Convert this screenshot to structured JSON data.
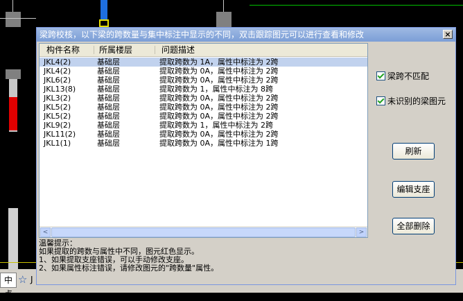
{
  "dialog": {
    "title": "梁跨校核，以下梁的跨数量与集中标注中显示的不同，双击跟踪图元可以进行查看和修改",
    "close_glyph": "×",
    "columns": [
      "构件名称",
      "所属楼层",
      "问题描述"
    ],
    "rows": [
      {
        "name": "JKL4(2)",
        "floor": "基础层",
        "desc": "提取跨数为 1A，属性中标注为 2跨"
      },
      {
        "name": "JKL4(2)",
        "floor": "基础层",
        "desc": "提取跨数为 0A，属性中标注为 2跨"
      },
      {
        "name": "JKL6(2)",
        "floor": "基础层",
        "desc": "提取跨数为 0A，属性中标注为 2跨"
      },
      {
        "name": "JKL13(8)",
        "floor": "基础层",
        "desc": "提取跨数为 1，属性中标注为 8跨"
      },
      {
        "name": "JKL3(2)",
        "floor": "基础层",
        "desc": "提取跨数为 0A，属性中标注为 2跨"
      },
      {
        "name": "JKL5(2)",
        "floor": "基础层",
        "desc": "提取跨数为 0A，属性中标注为 2跨"
      },
      {
        "name": "JKL5(2)",
        "floor": "基础层",
        "desc": "提取跨数为 0A，属性中标注为 2跨"
      },
      {
        "name": "JKL9(2)",
        "floor": "基础层",
        "desc": "提取跨数为 1，属性中标注为 2跨"
      },
      {
        "name": "JKL11(2)",
        "floor": "基础层",
        "desc": "提取跨数为 0A，属性中标注为 2跨"
      },
      {
        "name": "JKL1(1)",
        "floor": "基础层",
        "desc": "提取跨数为 0A，属性中标注为 1跨"
      }
    ],
    "selected_row": 0,
    "hints": [
      "温馨提示：",
      "如果提取的跨数与属性中不同，图元红色显示。",
      "1、如果提取支座错误，可以手动修改支座。",
      "2、如果属性标注错误，请修改图元的\"跨数量\"属性。"
    ],
    "checkboxes": [
      {
        "label": "梁跨不匹配",
        "checked": true
      },
      {
        "label": "未识别的梁图元",
        "checked": true
      }
    ],
    "buttons": {
      "refresh": "刷新",
      "edit_support": "编辑支座",
      "delete_all": "全部删除"
    },
    "scroll_left_glyph": "<",
    "scroll_right_glyph": ">"
  },
  "statusbar": {
    "left_text": "中点",
    "right_text": "J"
  },
  "colors": {
    "title_bar": "#7b9ed6",
    "selected_row": "#c1d2ee",
    "beam_red": "#e00000",
    "beam_blue": "#1e6fe0"
  }
}
